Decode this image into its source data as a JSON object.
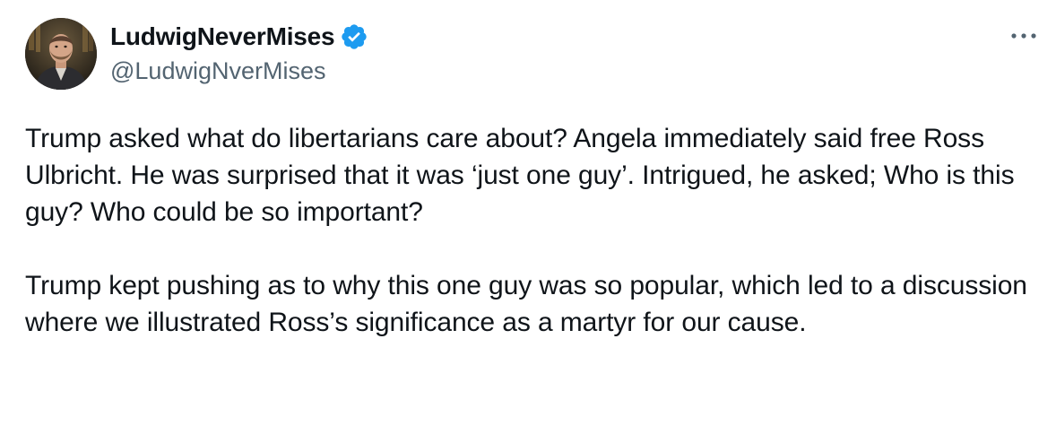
{
  "tweet": {
    "author": {
      "display_name": "LudwigNeverMises",
      "handle": "@LudwigNverMises",
      "verified": true,
      "verified_color": "#1d9bf0"
    },
    "more_icon": "ellipsis-icon",
    "paragraphs": [
      "Trump asked what do libertarians care about? Angela immediately said free Ross Ulbricht. He was surprised that it was ‘just one guy’. Intrigued, he asked; Who is this guy? Who could be so important?",
      "Trump kept pushing as to why this one guy was so popular, which led to a discussion where we illustrated Ross’s significance as a martyr for our cause."
    ]
  },
  "colors": {
    "text_primary": "#0f1419",
    "text_secondary": "#536471",
    "background": "#ffffff"
  }
}
